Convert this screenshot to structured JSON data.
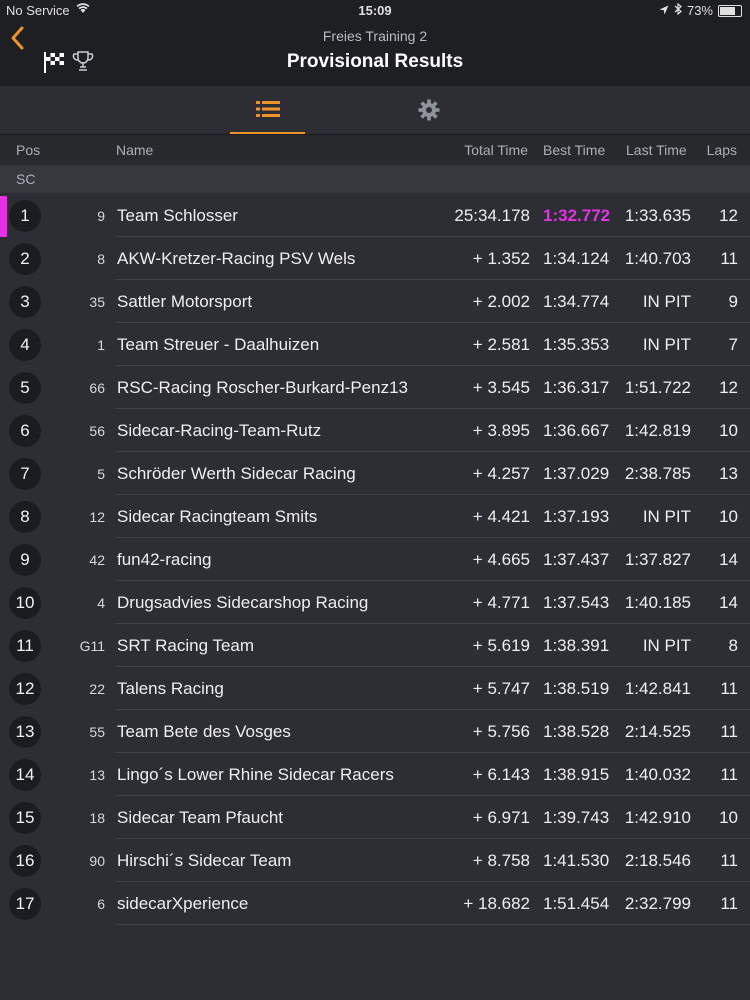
{
  "status": {
    "carrier": "No Service",
    "time": "15:09",
    "battery": "73%",
    "battery_level": 0.73
  },
  "nav": {
    "back_icon": "chevron-left-icon",
    "subtitle": "Freies Training 2",
    "title": "Provisional Results",
    "accent": "#f0922b"
  },
  "tabs": [
    {
      "icon": "list-icon",
      "selected": true
    },
    {
      "icon": "gear-icon",
      "selected": false
    }
  ],
  "columns": {
    "pos": "Pos",
    "name": "Name",
    "total": "Total Time",
    "best": "Best Time",
    "last": "Last Time",
    "laps": "Laps"
  },
  "section_label": "SC",
  "highlight_color": "#e333e3",
  "results": [
    {
      "pos": "1",
      "num": "9",
      "name": "Team Schlosser",
      "total": "25:34.178",
      "best": "1:32.772",
      "last": "1:33.635",
      "laps": "12",
      "best_overall": true
    },
    {
      "pos": "2",
      "num": "8",
      "name": "AKW-Kretzer-Racing  PSV Wels",
      "total": "+ 1.352",
      "best": "1:34.124",
      "last": "1:40.703",
      "laps": "11"
    },
    {
      "pos": "3",
      "num": "35",
      "name": "Sattler Motorsport",
      "total": "+ 2.002",
      "best": "1:34.774",
      "last": "IN PIT",
      "laps": "9"
    },
    {
      "pos": "4",
      "num": "1",
      "name": "Team Streuer - Daalhuizen",
      "total": "+ 2.581",
      "best": "1:35.353",
      "last": "IN PIT",
      "laps": "7"
    },
    {
      "pos": "5",
      "num": "66",
      "name": "RSC-Racing Roscher-Burkard-Penz13",
      "total": "+ 3.545",
      "best": "1:36.317",
      "last": "1:51.722",
      "laps": "12"
    },
    {
      "pos": "6",
      "num": "56",
      "name": "Sidecar-Racing-Team-Rutz",
      "total": "+ 3.895",
      "best": "1:36.667",
      "last": "1:42.819",
      "laps": "10"
    },
    {
      "pos": "7",
      "num": "5",
      "name": "Schröder Werth Sidecar Racing",
      "total": "+ 4.257",
      "best": "1:37.029",
      "last": "2:38.785",
      "laps": "13"
    },
    {
      "pos": "8",
      "num": "12",
      "name": "Sidecar Racingteam Smits",
      "total": "+ 4.421",
      "best": "1:37.193",
      "last": "IN PIT",
      "laps": "10"
    },
    {
      "pos": "9",
      "num": "42",
      "name": "fun42-racing",
      "total": "+ 4.665",
      "best": "1:37.437",
      "last": "1:37.827",
      "laps": "14"
    },
    {
      "pos": "10",
      "num": "4",
      "name": "Drugsadvies Sidecarshop Racing",
      "total": "+ 4.771",
      "best": "1:37.543",
      "last": "1:40.185",
      "laps": "14"
    },
    {
      "pos": "11",
      "num": "G11",
      "name": "SRT Racing Team",
      "total": "+ 5.619",
      "best": "1:38.391",
      "last": "IN PIT",
      "laps": "8"
    },
    {
      "pos": "12",
      "num": "22",
      "name": "Talens Racing",
      "total": "+ 5.747",
      "best": "1:38.519",
      "last": "1:42.841",
      "laps": "11"
    },
    {
      "pos": "13",
      "num": "55",
      "name": "Team Bete des Vosges",
      "total": "+ 5.756",
      "best": "1:38.528",
      "last": "2:14.525",
      "laps": "11"
    },
    {
      "pos": "14",
      "num": "13",
      "name": "Lingo´s Lower Rhine Sidecar Racers",
      "total": "+ 6.143",
      "best": "1:38.915",
      "last": "1:40.032",
      "laps": "11"
    },
    {
      "pos": "15",
      "num": "18",
      "name": "Sidecar Team Pfaucht",
      "total": "+ 6.971",
      "best": "1:39.743",
      "last": "1:42.910",
      "laps": "10"
    },
    {
      "pos": "16",
      "num": "90",
      "name": "Hirschi´s Sidecar Team",
      "total": "+ 8.758",
      "best": "1:41.530",
      "last": "2:18.546",
      "laps": "11"
    },
    {
      "pos": "17",
      "num": "6",
      "name": "sidecarXperience",
      "total": "+ 18.682",
      "best": "1:51.454",
      "last": "2:32.799",
      "laps": "11"
    }
  ]
}
